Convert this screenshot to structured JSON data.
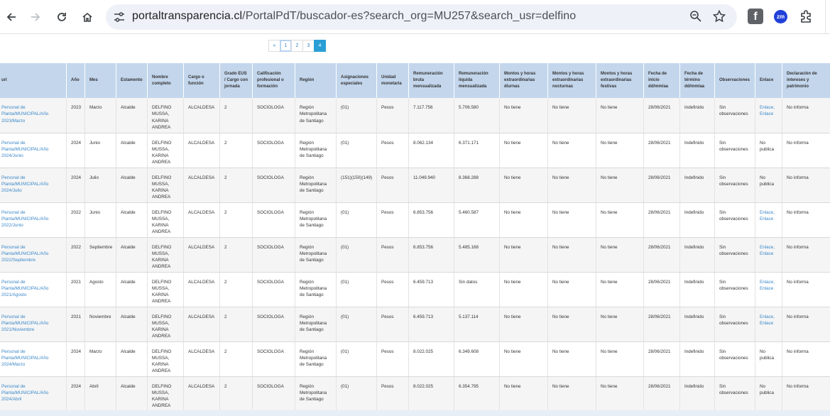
{
  "browser": {
    "url_host": "portaltransparencia.cl",
    "url_path": "/PortalPdT/buscador-es?search_org=MU257&search_usr=delfino",
    "ext_fb": "f",
    "ext_zm": "zm"
  },
  "pagination": {
    "prev": "«",
    "pages": [
      "1",
      "2",
      "3",
      "4"
    ],
    "active_index": 3
  },
  "table": {
    "headers": [
      "url",
      "Año",
      "Mes",
      "Estamento",
      "Nombre completo",
      "Cargo o función",
      "Grado EUS / Cargo con jornada",
      "Calificación profesional o formación",
      "Región",
      "Asignaciones especiales",
      "Unidad monetaria",
      "Remuneración bruta mensualizada",
      "Remuneración líquida mensualizada",
      "Montos y horas extraordinarias diurnas",
      "Montos y horas extraordinarias nocturnas",
      "Montos y horas extraordinarias festivas",
      "Fecha de inicio dd/mm/aa",
      "Fecha de término dd/mm/aa",
      "Observaciones",
      "Enlace",
      "Declaración de intereses y patrimonio"
    ],
    "rows": [
      {
        "url": "Personal de Planta/MUNICIPAL/Año 2023/Marzo",
        "anio": "2023",
        "mes": "Marzo",
        "estamento": "Alcalde",
        "nombre": "DELFINO MUSSA, KARINA ANDREA",
        "cargo": "ALCALDESA",
        "grado": "2",
        "calificacion": "SOCIOLOGA",
        "region": "Región Metropolitana de Santiago",
        "asignaciones": "(01)",
        "unidad": "Pesos",
        "bruta": "7.117.756",
        "liquida": "5.706.580",
        "diurnas": "No tiene",
        "nocturnas": "No tiene",
        "festivas": "No tiene",
        "inicio": "28/06/2021",
        "termino": "Indefinido",
        "obs": "Sin observaciones",
        "enlace": "Enlace, Enlace",
        "enlace_link": true,
        "declaracion": "No informa"
      },
      {
        "url": "Personal de Planta/MUNICIPAL/Año 2024/Junio",
        "anio": "2024",
        "mes": "Junio",
        "estamento": "Alcalde",
        "nombre": "DELFINO MUSSA, KARINA ANDREA",
        "cargo": "ALCALDESA",
        "grado": "2",
        "calificacion": "SOCIOLOGA",
        "region": "Región Metropolitana de Santiago",
        "asignaciones": "(01)",
        "unidad": "Pesos",
        "bruta": "8.062.134",
        "liquida": "6.371.171",
        "diurnas": "No tiene",
        "nocturnas": "No tiene",
        "festivas": "No tiene",
        "inicio": "28/06/2021",
        "termino": "Indefinido",
        "obs": "Sin observaciones",
        "enlace": "No publica",
        "enlace_link": false,
        "declaracion": "No informa"
      },
      {
        "url": "Personal de Planta/MUNICIPAL/Año 2024/Julio",
        "anio": "2024",
        "mes": "Julio",
        "estamento": "Alcalde",
        "nombre": "DELFINO MUSSA, KARINA ANDREA",
        "cargo": "ALCALDESA",
        "grado": "2",
        "calificacion": "SOCIOLOGA",
        "region": "Región Metropolitana de Santiago",
        "asignaciones": "(151)(150)(149)",
        "unidad": "Pesos",
        "bruta": "11.049.940",
        "liquida": "8.368.288",
        "diurnas": "No tiene",
        "nocturnas": "No tiene",
        "festivas": "No tiene",
        "inicio": "28/06/2021",
        "termino": "Indefinido",
        "obs": "Sin observaciones",
        "enlace": "No publica",
        "enlace_link": false,
        "declaracion": "No informa"
      },
      {
        "url": "Personal de Planta/MUNICIPAL/Año 2022/Junio",
        "anio": "2022",
        "mes": "Junio",
        "estamento": "Alcalde",
        "nombre": "DELFINO MUSSA, KARINA ANDREA",
        "cargo": "ALCALDESA",
        "grado": "2",
        "calificacion": "SOCIOLOGA",
        "region": "Región Metropolitana de Santiago",
        "asignaciones": "(01)",
        "unidad": "Pesos",
        "bruta": "6.853.756",
        "liquida": "5.460.587",
        "diurnas": "No tiene",
        "nocturnas": "No tiene",
        "festivas": "No tiene",
        "inicio": "28/06/2021",
        "termino": "Indefinido",
        "obs": "Sin observaciones",
        "enlace": "Enlace, Enlace",
        "enlace_link": true,
        "declaracion": "No informa"
      },
      {
        "url": "Personal de Planta/MUNICIPAL/Año 2022/Septiembre",
        "anio": "2022",
        "mes": "Septiembre",
        "estamento": "Alcalde",
        "nombre": "DELFINO MUSSA, KARINA ANDREA",
        "cargo": "ALCALDESA",
        "grado": "2",
        "calificacion": "SOCIOLOGA",
        "region": "Región Metropolitana de Santiago",
        "asignaciones": "(01)",
        "unidad": "Pesos",
        "bruta": "6.853.756",
        "liquida": "5.485.168",
        "diurnas": "No tiene",
        "nocturnas": "No tiene",
        "festivas": "No tiene",
        "inicio": "28/06/2021",
        "termino": "Indefinido",
        "obs": "Sin observaciones",
        "enlace": "Enlace, Enlace",
        "enlace_link": true,
        "declaracion": "No informa"
      },
      {
        "url": "Personal de Planta/MUNICIPAL/Año 2021/Agosto",
        "anio": "2021",
        "mes": "Agosto",
        "estamento": "Alcalde",
        "nombre": "DELFINO MUSSA, KARINA ANDREA",
        "cargo": "ALCALDESA",
        "grado": "2",
        "calificacion": "SOCIOLOGA",
        "region": "Región Metropolitana de Santiago",
        "asignaciones": "(01)",
        "unidad": "Pesos",
        "bruta": "6.459.713",
        "liquida": "Sin datos",
        "diurnas": "No tiene",
        "nocturnas": "No tiene",
        "festivas": "No tiene",
        "inicio": "28/06/2021",
        "termino": "Indefinido",
        "obs": "Sin observaciones",
        "enlace": "Enlace, Enlace",
        "enlace_link": true,
        "declaracion": "No informa"
      },
      {
        "url": "Personal de Planta/MUNICIPAL/Año 2021/Noviembre",
        "anio": "2021",
        "mes": "Noviembre",
        "estamento": "Alcalde",
        "nombre": "DELFINO MUSSA, KARINA ANDREA",
        "cargo": "ALCALDESA",
        "grado": "2",
        "calificacion": "SOCIOLOGA",
        "region": "Región Metropolitana de Santiago",
        "asignaciones": "(01)",
        "unidad": "Pesos",
        "bruta": "6.459.713",
        "liquida": "5.137.114",
        "diurnas": "No tiene",
        "nocturnas": "No tiene",
        "festivas": "No tiene",
        "inicio": "28/06/2021",
        "termino": "Indefinido",
        "obs": "Sin observaciones",
        "enlace": "Enlace, Enlace",
        "enlace_link": true,
        "declaracion": "No informa"
      },
      {
        "url": "Personal de Planta/MUNICIPAL/Año 2024/Marzo",
        "anio": "2024",
        "mes": "Marzo",
        "estamento": "Alcalde",
        "nombre": "DELFINO MUSSA, KARINA ANDREA",
        "cargo": "ALCALDESA",
        "grado": "2",
        "calificacion": "SOCIOLOGA",
        "region": "Región Metropolitana de Santiago",
        "asignaciones": "(01)",
        "unidad": "Pesos",
        "bruta": "8.022.025",
        "liquida": "6.349.608",
        "diurnas": "No tiene",
        "nocturnas": "No tiene",
        "festivas": "No tiene",
        "inicio": "28/06/2021",
        "termino": "Indefinido",
        "obs": "Sin observaciones",
        "enlace": "No publica",
        "enlace_link": false,
        "declaracion": "No informa"
      },
      {
        "url": "Personal de Planta/MUNICIPAL/Año 2024/Abril",
        "anio": "2024",
        "mes": "Abril",
        "estamento": "Alcalde",
        "nombre": "DELFINO MUSSA, KARINA ANDREA",
        "cargo": "ALCALDESA",
        "grado": "2",
        "calificacion": "SOCIOLOGA",
        "region": "Región Metropolitana de Santiago",
        "asignaciones": "(01)",
        "unidad": "Pesos",
        "bruta": "8.022.025",
        "liquida": "6.354.795",
        "diurnas": "No tiene",
        "nocturnas": "No tiene",
        "festivas": "No tiene",
        "inicio": "28/06/2021",
        "termino": "Indefinido",
        "obs": "Sin observaciones",
        "enlace": "No publica",
        "enlace_link": false,
        "declaracion": "No informa"
      }
    ]
  }
}
